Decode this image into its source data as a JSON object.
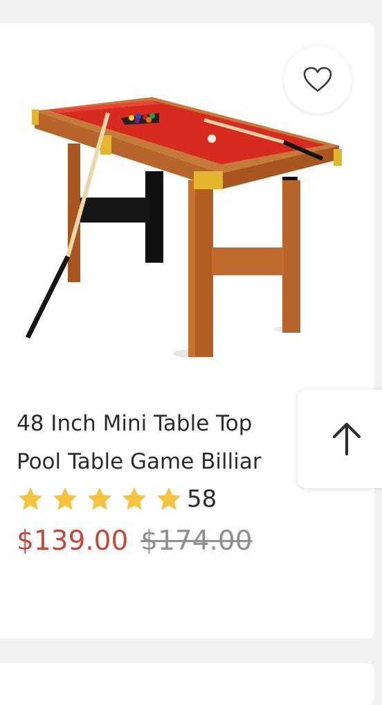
{
  "product": {
    "title_line1": "48 Inch Mini Table Top",
    "title_line2": "Pool Table Game Billiar",
    "image_alt": "Mini pool table with red felt, cue stick and balls",
    "rating": {
      "stars": 5,
      "max_stars": 5,
      "review_count": "58",
      "star_color": "#f7c23d"
    },
    "price": {
      "current": "$139.00",
      "original": "$174.00",
      "current_color": "#c6483b"
    }
  },
  "icons": {
    "favorite": "heart-outline-icon",
    "back_to_top": "arrow-up-icon",
    "star": "star-icon"
  }
}
